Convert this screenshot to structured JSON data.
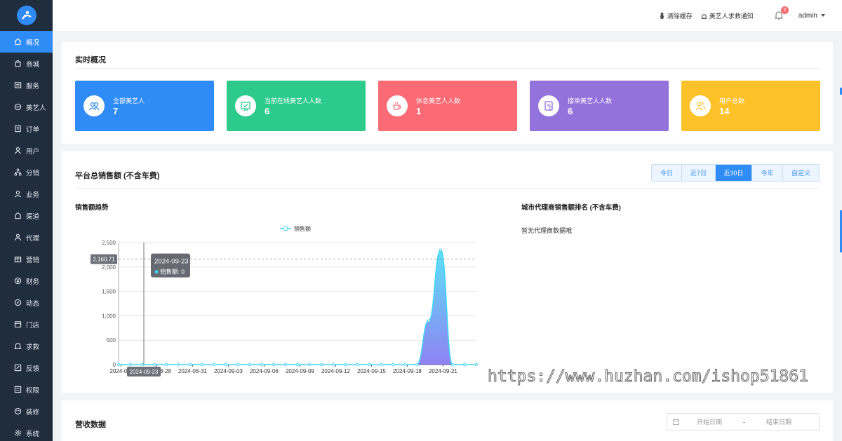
{
  "sidebar": {
    "items": [
      {
        "label": "概况",
        "icon": "home-icon"
      },
      {
        "label": "商城",
        "icon": "shop-icon"
      },
      {
        "label": "服务",
        "icon": "service-icon"
      },
      {
        "label": "美艺人",
        "icon": "artist-icon"
      },
      {
        "label": "订单",
        "icon": "order-icon"
      },
      {
        "label": "用户",
        "icon": "user-icon"
      },
      {
        "label": "分销",
        "icon": "distribution-icon"
      },
      {
        "label": "业务",
        "icon": "business-icon"
      },
      {
        "label": "渠道",
        "icon": "channel-icon"
      },
      {
        "label": "代理",
        "icon": "agent-icon"
      },
      {
        "label": "营销",
        "icon": "marketing-icon"
      },
      {
        "label": "财务",
        "icon": "finance-icon"
      },
      {
        "label": "动态",
        "icon": "activity-icon"
      },
      {
        "label": "门店",
        "icon": "store-icon"
      },
      {
        "label": "求救",
        "icon": "sos-icon"
      },
      {
        "label": "反馈",
        "icon": "feedback-icon"
      },
      {
        "label": "权限",
        "icon": "permission-icon"
      },
      {
        "label": "装修",
        "icon": "decoration-icon"
      },
      {
        "label": "系统",
        "icon": "settings-icon"
      }
    ]
  },
  "header": {
    "clear_cache": "清除缓存",
    "sos_notice": "美艺人求救通知",
    "notification_count": "3",
    "user": "admin"
  },
  "overview": {
    "title": "实时概况",
    "stats": [
      {
        "label": "全部美艺人",
        "value": "7",
        "color": "#2f8bf5",
        "icon": "users-icon"
      },
      {
        "label": "当前在线美艺人人数",
        "value": "6",
        "color": "#2dcb8b",
        "icon": "online-monitor-icon"
      },
      {
        "label": "休息美艺人人数",
        "value": "1",
        "color": "#fb6b76",
        "icon": "coffee-icon"
      },
      {
        "label": "接单美艺人人数",
        "value": "6",
        "color": "#9472dc",
        "icon": "order-list-icon"
      },
      {
        "label": "用户总数",
        "value": "14",
        "color": "#fdc22a",
        "icon": "user-group-icon"
      }
    ]
  },
  "sales": {
    "title": "平台总销售额 (不含车费)",
    "tabs": [
      "今日",
      "近7日",
      "近30日",
      "今年",
      "自定义"
    ],
    "active_tab": 2,
    "trend_title": "销售额趋势",
    "ranking_title": "城市代理商销售额排名 (不含车费)",
    "ranking_empty": "暂无代理商数据哦",
    "tooltip": {
      "date": "2024-09-23",
      "label": "销售额: 0"
    },
    "crosshair_y_label": "2,160.71",
    "crosshair_x_label": "2024-09-23"
  },
  "revenue": {
    "title": "营收数据",
    "start_placeholder": "开始日期",
    "separator": "-",
    "end_placeholder": "结束日期"
  },
  "watermark": "https://www.huzhan.com/ishop51861",
  "chart_data": {
    "type": "area",
    "legend": [
      "销售额"
    ],
    "x_ticks": [
      "2024-08-",
      "2024-08-28",
      "2024-08-31",
      "2024-09-03",
      "2024-09-06",
      "2024-09-09",
      "2024-09-12",
      "2024-09-15",
      "2024-09-18",
      "2024-09-21"
    ],
    "y_ticks": [
      "0",
      "500",
      "1,000",
      "1,500",
      "2,000",
      "2,500"
    ],
    "ylim": [
      0,
      2500
    ],
    "series": [
      {
        "name": "销售额",
        "x": [
          "2024-08-24",
          "2024-08-25",
          "2024-08-26",
          "2024-08-27",
          "2024-08-28",
          "2024-08-29",
          "2024-08-30",
          "2024-08-31",
          "2024-09-01",
          "2024-09-02",
          "2024-09-03",
          "2024-09-04",
          "2024-09-05",
          "2024-09-06",
          "2024-09-07",
          "2024-09-08",
          "2024-09-09",
          "2024-09-10",
          "2024-09-11",
          "2024-09-12",
          "2024-09-13",
          "2024-09-14",
          "2024-09-15",
          "2024-09-16",
          "2024-09-17",
          "2024-09-18",
          "2024-09-19",
          "2024-09-20",
          "2024-09-21",
          "2024-09-22",
          "2024-09-23"
        ],
        "values": [
          0,
          0,
          0,
          0,
          0,
          0,
          0,
          0,
          0,
          0,
          0,
          0,
          0,
          0,
          0,
          0,
          0,
          0,
          0,
          0,
          0,
          0,
          0,
          0,
          0,
          0,
          900,
          2350,
          0,
          0,
          0
        ]
      }
    ],
    "grid": true,
    "color": "#3dd5f3"
  }
}
